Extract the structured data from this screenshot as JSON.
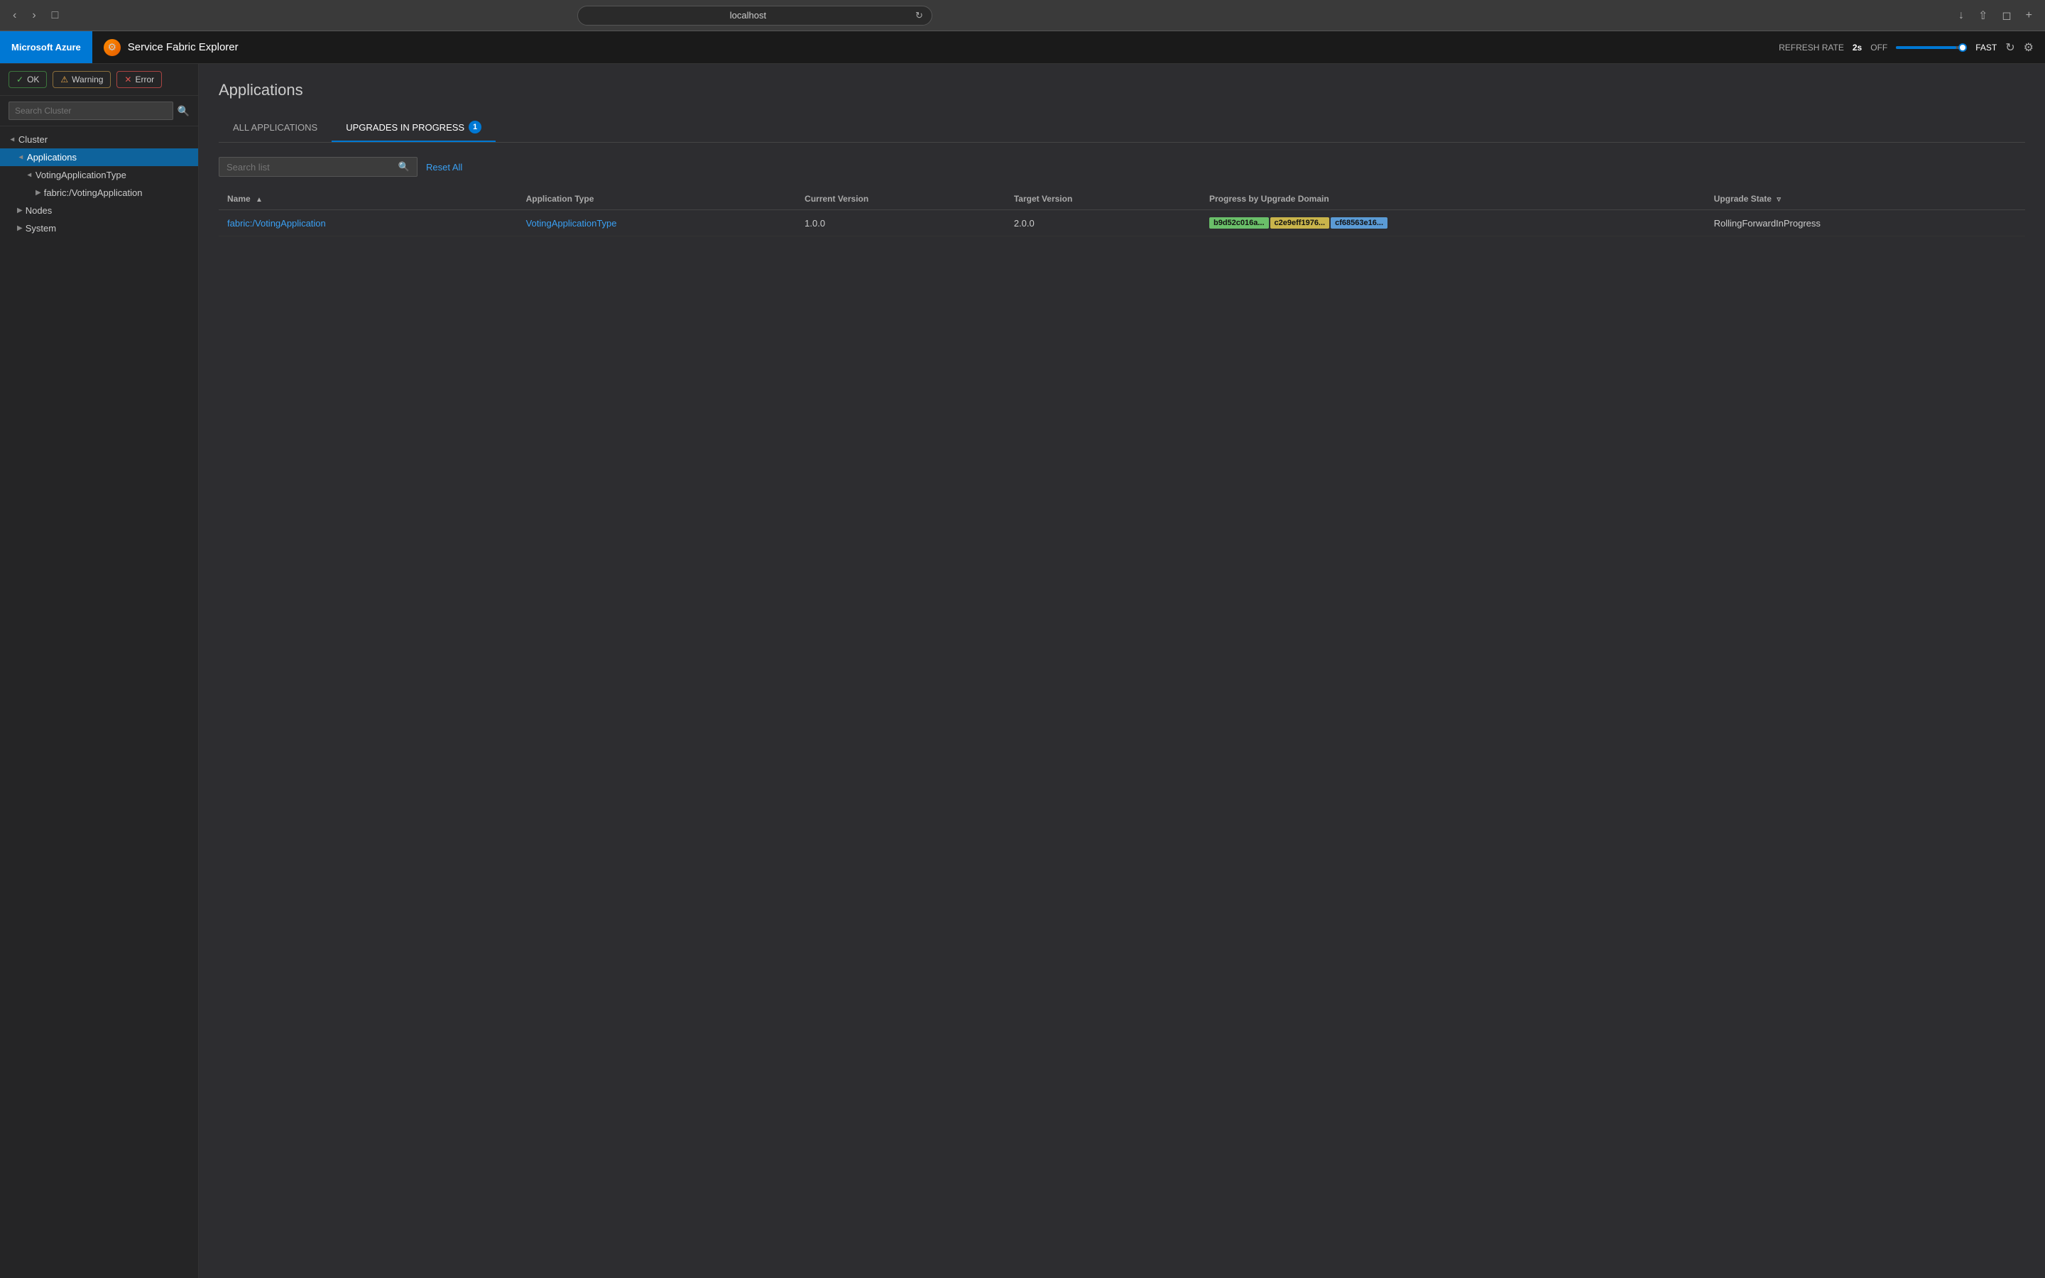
{
  "browser": {
    "url": "localhost",
    "refresh_icon": "↻"
  },
  "topbar": {
    "azure_brand": "Microsoft Azure",
    "app_icon": "⚙",
    "app_title": "Service Fabric Explorer",
    "refresh_rate_label": "REFRESH RATE",
    "refresh_value": "2s",
    "refresh_toggle": "OFF",
    "fast_label": "FAST",
    "refresh_icon": "↻",
    "gear_icon": "⚙"
  },
  "sidebar": {
    "status_buttons": [
      {
        "id": "ok",
        "label": "OK",
        "icon": "✓",
        "type": "ok"
      },
      {
        "id": "warning",
        "label": "Warning",
        "icon": "⚠",
        "type": "warning"
      },
      {
        "id": "error",
        "label": "Error",
        "icon": "✕",
        "type": "error"
      }
    ],
    "search_placeholder": "Search Cluster",
    "tree": [
      {
        "id": "cluster",
        "label": "Cluster",
        "level": 0,
        "open": true,
        "chevron": "open"
      },
      {
        "id": "applications",
        "label": "Applications",
        "level": 1,
        "open": true,
        "chevron": "open",
        "selected": true
      },
      {
        "id": "votingapptype",
        "label": "VotingApplicationType",
        "level": 2,
        "open": true,
        "chevron": "open"
      },
      {
        "id": "fabricvoting",
        "label": "fabric:/VotingApplication",
        "level": 3,
        "open": false,
        "chevron": "closed"
      },
      {
        "id": "nodes",
        "label": "Nodes",
        "level": 1,
        "open": false,
        "chevron": "closed"
      },
      {
        "id": "system",
        "label": "System",
        "level": 1,
        "open": false,
        "chevron": "closed"
      }
    ]
  },
  "content": {
    "page_title": "Applications",
    "tabs": [
      {
        "id": "all",
        "label": "ALL APPLICATIONS",
        "active": false
      },
      {
        "id": "upgrades",
        "label": "UPGRADES IN PROGRESS",
        "active": true,
        "badge": "1"
      }
    ],
    "search_placeholder": "Search list",
    "reset_all_label": "Reset All",
    "table": {
      "columns": [
        {
          "id": "name",
          "label": "Name",
          "sort": "▲"
        },
        {
          "id": "apptype",
          "label": "Application Type"
        },
        {
          "id": "current",
          "label": "Current Version"
        },
        {
          "id": "target",
          "label": "Target Version"
        },
        {
          "id": "progress",
          "label": "Progress by Upgrade Domain"
        },
        {
          "id": "state",
          "label": "Upgrade State",
          "filter": true
        }
      ],
      "rows": [
        {
          "name": "fabric:/VotingApplication",
          "app_type": "VotingApplicationType",
          "current_version": "1.0.0",
          "target_version": "2.0.0",
          "domains": [
            {
              "label": "b9d52c016a...",
              "color": "green"
            },
            {
              "label": "c2e9eff1976...",
              "color": "yellow"
            },
            {
              "label": "cf68563e16...",
              "color": "blue"
            }
          ],
          "upgrade_state": "RollingForwardInProgress"
        }
      ]
    }
  }
}
